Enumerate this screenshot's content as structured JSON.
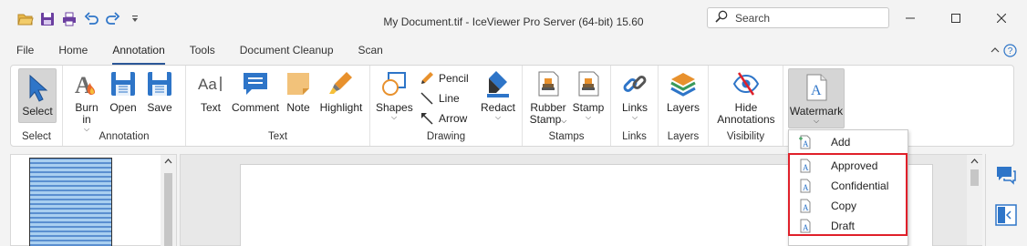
{
  "window": {
    "title": "My Document.tif - IceViewer Pro Server (64-bit) 15.60",
    "search_placeholder": "Search"
  },
  "quick_access": [
    "open-folder-icon",
    "save-icon",
    "print-icon",
    "undo-icon",
    "redo-icon",
    "customize-icon"
  ],
  "tabs": [
    "File",
    "Home",
    "Annotation",
    "Tools",
    "Document Cleanup",
    "Scan"
  ],
  "active_tab": "Annotation",
  "ribbon": {
    "groups": {
      "select": "Select",
      "annotation": "Annotation",
      "text": "Text",
      "drawing": "Drawing",
      "stamps": "Stamps",
      "links": "Links",
      "layers": "Layers",
      "visibility": "Visibility"
    },
    "buttons": {
      "select": "Select",
      "burn_in_1": "Burn",
      "burn_in_2": "in",
      "open": "Open",
      "save": "Save",
      "text": "Text",
      "comment": "Comment",
      "note": "Note",
      "highlight": "Highlight",
      "shapes": "Shapes",
      "pencil": "Pencil",
      "line": "Line",
      "arrow": "Arrow",
      "redact": "Redact",
      "rubber_stamp_1": "Rubber",
      "rubber_stamp_2": "Stamp",
      "stamp": "Stamp",
      "links": "Links",
      "layers": "Layers",
      "hide_annotations_1": "Hide",
      "hide_annotations_2": "Annotations",
      "watermark": "Watermark"
    }
  },
  "watermark_menu": {
    "items": [
      "Add",
      "Approved",
      "Confidential",
      "Copy",
      "Draft"
    ]
  },
  "colors": {
    "accent": "#2b5797",
    "highlight_box": "#e0202a",
    "icon_blue": "#2e75c8",
    "icon_orange": "#e8912d"
  }
}
